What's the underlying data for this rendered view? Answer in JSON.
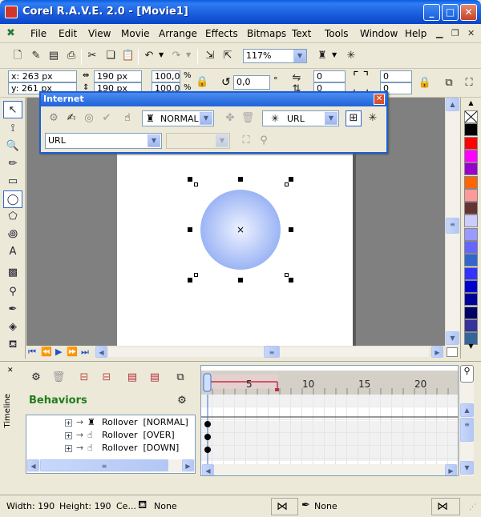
{
  "window": {
    "title": "Corel R.A.V.E. 2.0 - [Movie1]",
    "minimize_glyph": "_",
    "maximize_glyph": "□",
    "close_glyph": "✕"
  },
  "menubar": {
    "items": [
      {
        "label": "File"
      },
      {
        "label": "Edit"
      },
      {
        "label": "View"
      },
      {
        "label": "Movie"
      },
      {
        "label": "Arrange"
      },
      {
        "label": "Effects"
      },
      {
        "label": "Bitmaps"
      },
      {
        "label": "Text"
      },
      {
        "label": "Tools"
      },
      {
        "label": "Window"
      },
      {
        "label": "Help"
      }
    ]
  },
  "standard_toolbar": {
    "zoom_value": "117%"
  },
  "property_bar": {
    "x": "x: 263 px",
    "y": "y: 261 px",
    "width": "190 px",
    "height": "190 px",
    "scale_x": "100,0",
    "scale_y": "100,0",
    "percent": "%",
    "rotation": "0,0",
    "degree": "°",
    "corner1": "0",
    "corner2": "0",
    "corner3": "0",
    "corner4": "0"
  },
  "internet_window": {
    "title": "Internet",
    "behavior_state": "NORMAL",
    "link_type": "URL",
    "url_value": "URL"
  },
  "timeline": {
    "side_label": "Timeline",
    "behaviors_label": "Behaviors",
    "tree_items": [
      {
        "label": "Rollover  [NORMAL]"
      },
      {
        "label": "Rollover  [OVER]"
      },
      {
        "label": "Rollover  [DOWN]"
      }
    ],
    "frame_numbers": [
      "5",
      "10",
      "15",
      "20"
    ]
  },
  "statusbar": {
    "width": "Width: 190",
    "height": "Height: 190",
    "center": "Ce...",
    "fill": "None",
    "outline": "None"
  },
  "colors": {
    "palette": [
      "#ffffff",
      "#000000",
      "#ff0000",
      "#ff00ff",
      "#9900cc",
      "#ff6600",
      "#ff9999",
      "#663333",
      "#ccccff",
      "#9999ff",
      "#6666ff",
      "#3366cc",
      "#3333ff",
      "#0000cc",
      "#000099",
      "#000066",
      "#333399",
      "#336699"
    ],
    "circle_inner": "#e8eeff",
    "circle_outer": "#9bb4f5"
  }
}
